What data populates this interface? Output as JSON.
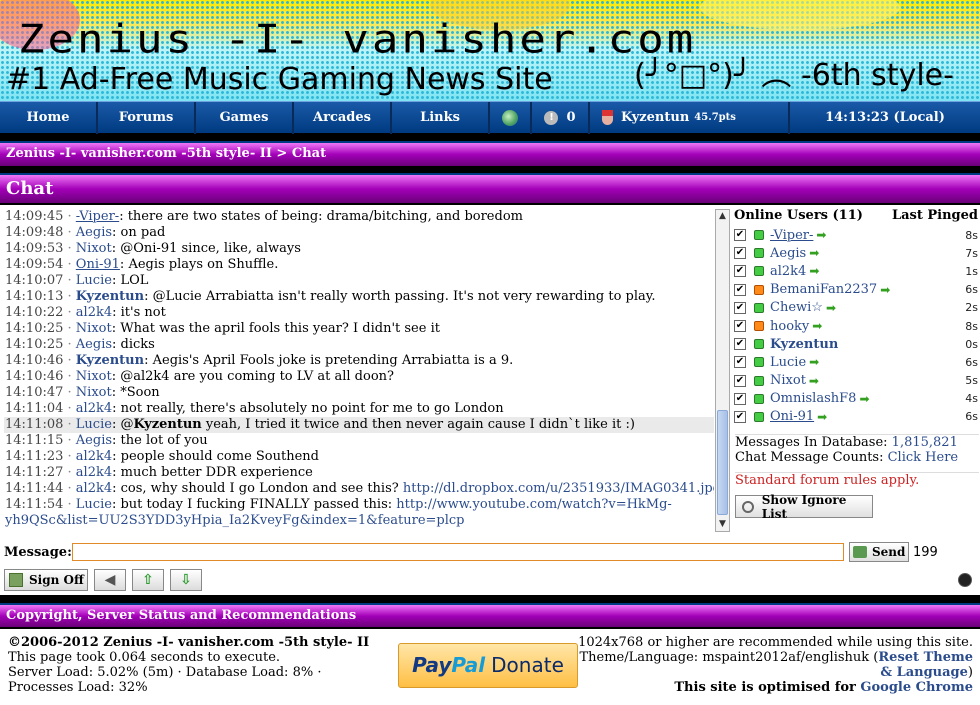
{
  "banner": {
    "title": "Zenius -I- vanisher.com",
    "subtitle": "#1 Ad-Free Music Gaming News Site",
    "face": "(╯°□°)╯ ︵ -6th style-"
  },
  "nav": {
    "items": [
      "Home",
      "Forums",
      "Games",
      "Arcades",
      "Links"
    ],
    "notifications": "0",
    "username": "Kyzentun",
    "points": "45.7pts",
    "time": "14:13:23 (Local)"
  },
  "breadcrumb": "Zenius -I- vanisher.com -5th style- II > Chat",
  "chat_title": "Chat",
  "messages": [
    {
      "time": "14:09:45",
      "user": "-Viper-",
      "text": "there are two states of being: drama/bitching, and boredom",
      "style": "u"
    },
    {
      "time": "14:09:48",
      "user": "Aegis",
      "text": "on pad",
      "style": ""
    },
    {
      "time": "14:09:53",
      "user": "Nixot",
      "text": "@Oni-91 since, like, always",
      "style": ""
    },
    {
      "time": "14:09:54",
      "user": "Oni-91",
      "text": "Aegis plays on Shuffle.",
      "style": "u"
    },
    {
      "time": "14:10:07",
      "user": "Lucie",
      "text": "LOL",
      "style": ""
    },
    {
      "time": "14:10:13",
      "user": "Kyzentun",
      "text": "@Lucie Arrabiatta isn't really worth passing. It's not very rewarding to play.",
      "style": "b"
    },
    {
      "time": "14:10:22",
      "user": "al2k4",
      "text": "it's not",
      "style": ""
    },
    {
      "time": "14:10:25",
      "user": "Nixot",
      "text": "What was the april fools this year? I didn't see it",
      "style": ""
    },
    {
      "time": "14:10:25",
      "user": "Aegis",
      "text": "dicks",
      "style": ""
    },
    {
      "time": "14:10:46",
      "user": "Kyzentun",
      "text": "Aegis's April Fools joke is pretending Arrabiatta is a 9.",
      "style": "b"
    },
    {
      "time": "14:10:46",
      "user": "Nixot",
      "text": "@al2k4 are you coming to LV at all doon?",
      "style": ""
    },
    {
      "time": "14:10:47",
      "user": "Nixot",
      "text": "*Soon",
      "style": ""
    },
    {
      "time": "14:11:04",
      "user": "al2k4",
      "text": "not really, there's absolutely no point for me to go London",
      "style": ""
    },
    {
      "time": "14:11:08",
      "user": "Lucie",
      "mention": "Kyzentun",
      "text": " yeah, I tried it twice and then never again cause I didn`t like it :)",
      "style": "",
      "hl": true
    },
    {
      "time": "14:11:15",
      "user": "Aegis",
      "text": "the lot of you",
      "style": ""
    },
    {
      "time": "14:11:23",
      "user": "al2k4",
      "text": "people should come Southend",
      "style": ""
    },
    {
      "time": "14:11:27",
      "user": "al2k4",
      "text": "much better DDR experience",
      "style": ""
    },
    {
      "time": "14:11:44",
      "user": "al2k4",
      "text": "cos, why should I go London and see this? ",
      "link": "http://dl.dropbox.com/u/2351933/IMAG0341.jpg",
      "style": ""
    },
    {
      "time": "14:11:54",
      "user": "Lucie",
      "text": "but today I fucking FINALLY passed this: ",
      "link": "http://www.youtube.com/watch?v=HkMg-yh9QSc&list=UU2S3YDD3yHpia_Ia2KveyFg&index=1&feature=plcp",
      "style": "",
      "wrap": true
    }
  ],
  "online": {
    "title": "Online Users (11)",
    "pinged_label": "Last Pinged",
    "users": [
      {
        "name": "-Viper-",
        "status": "green",
        "ping": "8s",
        "style": "u"
      },
      {
        "name": "Aegis",
        "status": "green",
        "ping": "7s",
        "style": ""
      },
      {
        "name": "al2k4",
        "status": "green",
        "ping": "1s",
        "style": ""
      },
      {
        "name": "BemaniFan2237",
        "status": "orange",
        "ping": "6s",
        "style": ""
      },
      {
        "name": "Chewi☆",
        "status": "green",
        "ping": "2s",
        "style": ""
      },
      {
        "name": "hooky",
        "status": "orange",
        "ping": "8s",
        "style": ""
      },
      {
        "name": "Kyzentun",
        "status": "green",
        "ping": "0s",
        "style": "b",
        "self": true
      },
      {
        "name": "Lucie",
        "status": "green",
        "ping": "6s",
        "style": ""
      },
      {
        "name": "Nixot",
        "status": "green",
        "ping": "5s",
        "style": ""
      },
      {
        "name": "OmnislashF8",
        "status": "green",
        "ping": "4s",
        "style": ""
      },
      {
        "name": "Oni-91",
        "status": "green",
        "ping": "6s",
        "style": "u"
      }
    ]
  },
  "stats": {
    "db_label": "Messages In Database:",
    "db_count": "1,815,821",
    "counts_label": "Chat Message Counts:",
    "counts_link": "Click Here"
  },
  "rules_text": "Standard forum rules apply.",
  "ignore_button": "Show Ignore List",
  "input": {
    "label": "Message:",
    "value": "",
    "send": "Send",
    "remaining": "199"
  },
  "signoff_label": "Sign Off",
  "footer": {
    "heading": "Copyright, Server Status and Recommendations",
    "copyright": "©2006-2012 Zenius -I- vanisher.com -5th style- II",
    "took": "This page took 0.064 seconds to execute.",
    "load": "Server Load: 5.02% (5m) · Database Load: 8% · Processes Load: 32%",
    "paypal_pay": "Pay",
    "paypal_pal": "Pal",
    "paypal_donate": "Donate",
    "recommend": "1024x768 or higher are recommended while using this site.",
    "theme_prefix": "Theme/Language: mspaint2012af/englishuk (",
    "theme_link": "Reset Theme & Language",
    "theme_suffix": ")",
    "optimised_prefix": "This site is optimised for",
    "optimised_link": "Google Chrome"
  },
  "colors": {
    "nav": "#003a80",
    "bar": "#a300b8",
    "link": "#2b4c8c",
    "rules": "#cc2222"
  }
}
